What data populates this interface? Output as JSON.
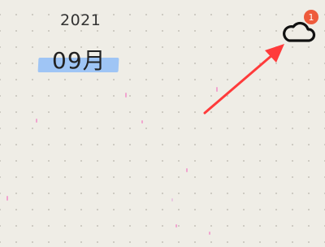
{
  "calendar": {
    "year": "2021",
    "month": "09月"
  },
  "sync": {
    "icon": "cloud-icon",
    "badge_count": "1",
    "badge_color": "#ee5b3c"
  },
  "colors": {
    "background": "#efede6",
    "month_highlight": "#9fc5f5",
    "arrow": "#ff3b3b"
  }
}
